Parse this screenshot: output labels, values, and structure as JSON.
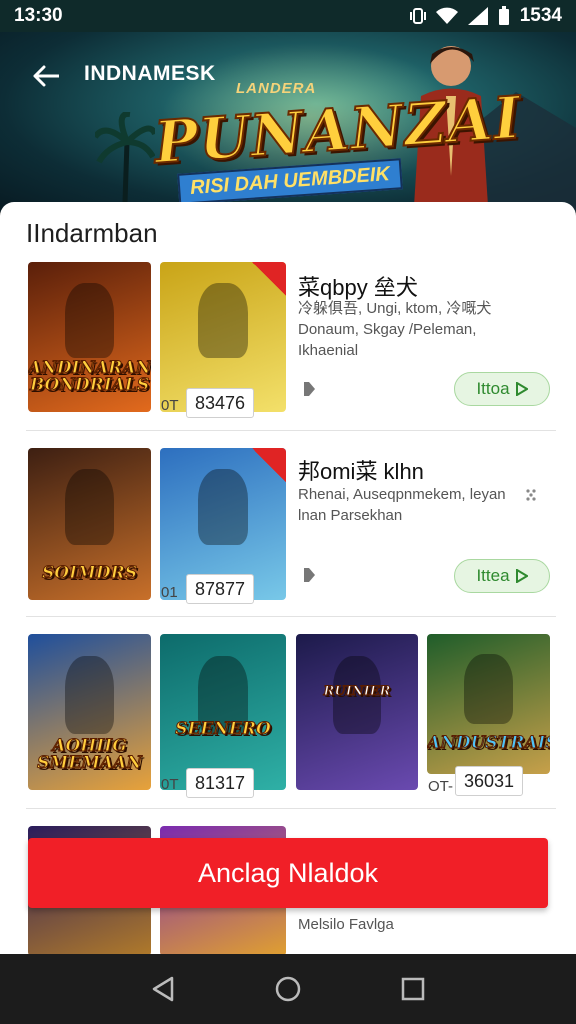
{
  "status_bar": {
    "time": "13:30",
    "battery": "1534"
  },
  "header": {
    "title": "INDNAMESK"
  },
  "banner": {
    "logo_small": "LANDERA",
    "logo_big": "PUNANZAI",
    "logo_sub": "RISI DAH UEMBDEIK"
  },
  "section": {
    "title": "IIndarmban"
  },
  "rows": [
    {
      "tiles": [
        {
          "label": "ANDINARAN BONDRIALS",
          "colors": [
            "#5a1f0a",
            "#e26a1d"
          ]
        },
        {
          "label": "",
          "colors": [
            "#c9a417",
            "#f3e06a"
          ]
        }
      ],
      "counter_prefix": "0T",
      "counter": "83476",
      "title": "菜qbpy 垒犬",
      "desc": "冷躲俱吾, Ungi, ktom, 冷嘅犬 Donaum, Skgay /Peleman, Ikhaenial",
      "button": "Ittoa"
    },
    {
      "tiles": [
        {
          "label": "SOIMDRS",
          "colors": [
            "#3d1f12",
            "#c8702a"
          ]
        },
        {
          "label": "",
          "colors": [
            "#2d6fbf",
            "#78c8e8"
          ]
        }
      ],
      "counter_prefix": "01",
      "counter": "87877",
      "title": "邦omi菜 klhn",
      "desc": "Rhenai, Auseqpnmekem, leyan lnan Parsekhan",
      "button": "Ittea"
    },
    {
      "tiles": [
        {
          "label": "AOHIIG SMEMAAN",
          "colors": [
            "#1f4f9c",
            "#e8a23a"
          ]
        },
        {
          "label": "SEENERO",
          "colors": [
            "#0d6b6b",
            "#2fb0a6"
          ]
        },
        {
          "label": "RUINIER",
          "colors": [
            "#1c1a4a",
            "#6a4ab0"
          ]
        },
        {
          "label": "ANDUSTRAIS",
          "colors": [
            "#1f5d2a",
            "#c7a04a"
          ]
        }
      ],
      "counter_prefix": "0T",
      "counter": "81317",
      "counter2_prefix": "OT-",
      "counter2": "36031"
    }
  ],
  "partial_row": {
    "desc": "Melsilo Favlga"
  },
  "cta": {
    "label": "Anclag Nlaldok"
  }
}
